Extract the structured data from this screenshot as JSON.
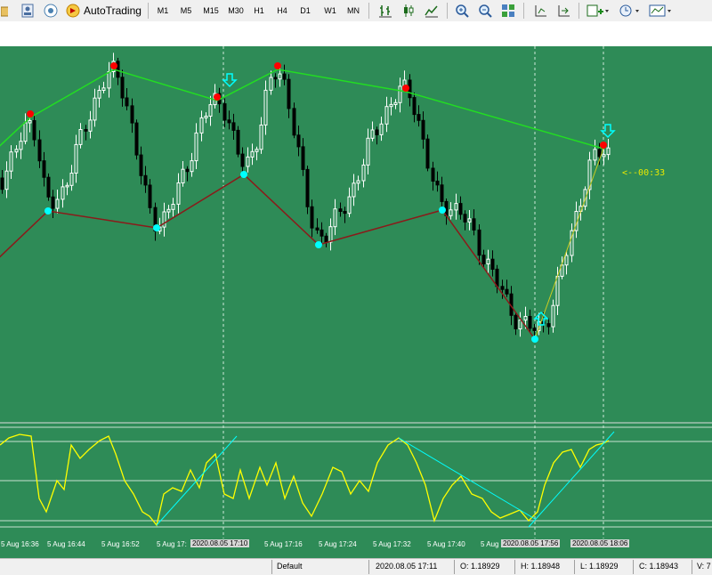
{
  "toolbar": {
    "autotrading_label": "AutoTrading",
    "timeframes": [
      "M1",
      "M5",
      "M15",
      "M30",
      "H1",
      "H4",
      "D1",
      "W1",
      "MN"
    ],
    "icons": [
      "folder-icon",
      "account-icon",
      "signal-icon",
      "autotrading-icon",
      "bar-chart-icon",
      "candlestick-icon",
      "line-chart-icon",
      "zoom-in-icon",
      "zoom-out-icon",
      "tile-windows-icon",
      "chart-shift-icon",
      "autoscroll-icon",
      "indicators-icon",
      "periods-icon",
      "templates-icon"
    ]
  },
  "chart": {
    "symbol_timer": "<--00:33",
    "colors": {
      "background": "#2e8b57",
      "bull": "#ffffff",
      "bear": "#000000",
      "resistance": "#22dd22",
      "support": "#8b1a1a",
      "peak": "#ff0000",
      "trough": "#00ffff",
      "oscillator": "#ffff00",
      "oscillator_trend": "#00ffff"
    },
    "time_labels": [
      "5 Aug 16:36",
      "5 Aug 16:44",
      "5 Aug 16:52",
      "5 Aug 17:",
      "2020.08.05 17:10",
      "5 Aug 17:16",
      "5 Aug 17:24",
      "5 Aug 17:32",
      "5 Aug 17:40",
      "5 Aug",
      "2020.08.05 17:56",
      "2020.08.05 18:06"
    ]
  },
  "status": {
    "profile": "Default",
    "datetime": "2020.08.05 17:11",
    "open": "O: 1.18929",
    "high": "H: 1.18948",
    "low": "L: 1.18929",
    "close": "C: 1.18943",
    "volume": "V: 7"
  }
}
